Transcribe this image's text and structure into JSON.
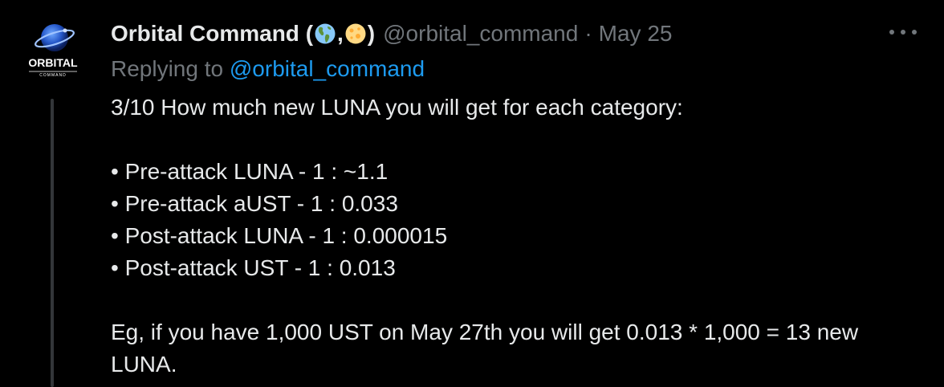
{
  "tweet": {
    "display_name": "Orbital Command (",
    "display_name_sep": ",",
    "display_name_end": ")",
    "emojis": [
      "globe-americas-emoji",
      "full-moon-emoji"
    ],
    "handle": "@orbital_command",
    "separator": "·",
    "date": "May 25",
    "replying_prefix": "Replying to",
    "replying_handle": "@orbital_command",
    "avatar": {
      "text": "ORBITAL",
      "subtext": "COMMAND"
    },
    "body": {
      "intro": "3/10 How much new LUNA you will get for each category:",
      "bullets": [
        "• Pre-attack LUNA - 1 : ~1.1",
        "• Pre-attack aUST - 1 : 0.033",
        "• Post-attack LUNA - 1 : 0.000015",
        "• Post-attack UST - 1 : 0.013"
      ],
      "example_line1": "Eg, if you have 1,000 UST on May 27th you will get 0.013 * 1,000 = 13 new",
      "example_line2": "LUNA."
    }
  },
  "colors": {
    "background": "#000000",
    "text_primary": "#e7e9ea",
    "text_secondary": "#71767b",
    "link": "#1d9bf0",
    "thread_line": "#333639"
  }
}
